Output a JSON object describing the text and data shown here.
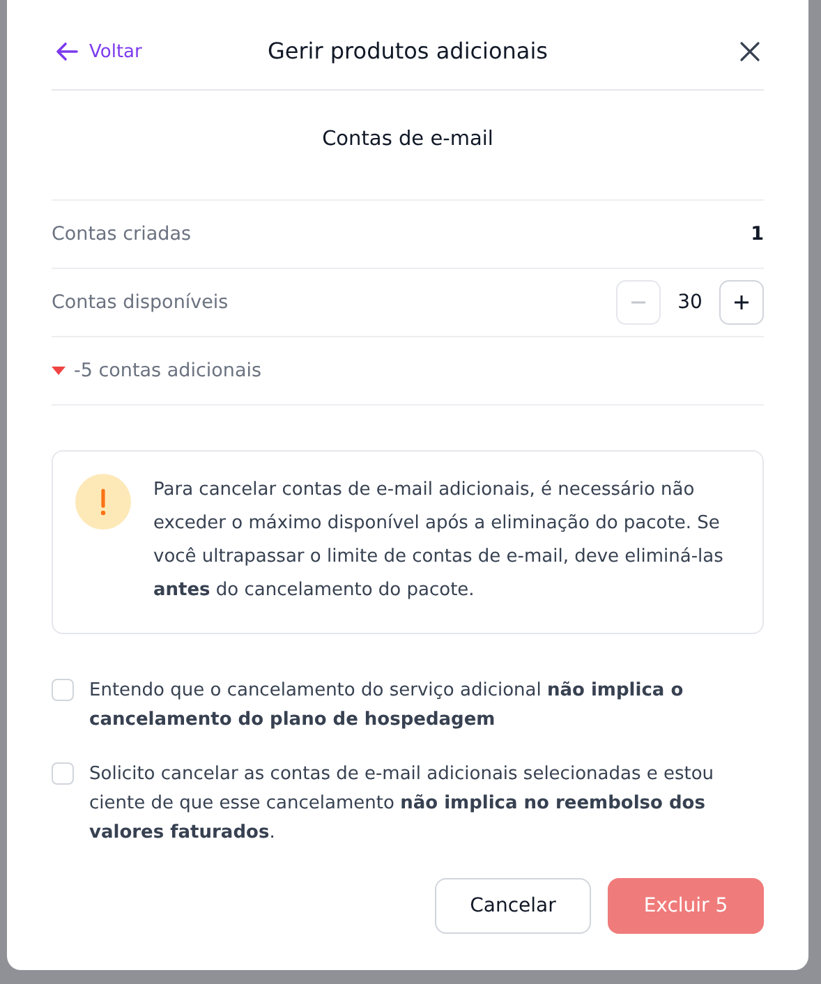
{
  "header": {
    "back": "Voltar",
    "title": "Gerir produtos adicionais"
  },
  "section_title": "Contas de e-mail",
  "rows": [
    {
      "kind": "value",
      "label": "Contas criadas",
      "value": "1"
    },
    {
      "kind": "stepper",
      "label": "Contas disponíveis",
      "value": "30",
      "minus_disabled": true,
      "plus_disabled": false
    },
    {
      "kind": "change",
      "label": "-5 contas adicionais",
      "decrease": true
    }
  ],
  "alert": {
    "text": "Para cancelar contas de e-mail adicionais, é necessário não exceder o máximo disponível após a eliminação do pacote. Se você ultrapassar o limite de contas de e-mail, deve eliminá-las **antes** do cancelamento do pacote."
  },
  "checkboxes": [
    {
      "label": "Entendo que o cancelamento do serviço adicional **não implica o cancelamento do plano de hospedagem**",
      "checked": false
    },
    {
      "label": "Solicito cancelar as contas de e-mail adicionais selecionadas e estou ciente de que esse cancelamento **não implica no reembolso dos valores faturados**.",
      "checked": false
    }
  ],
  "buttons": [
    {
      "kind": "secondary",
      "label": "Cancelar",
      "disabled": false
    },
    {
      "kind": "danger",
      "label": "Excluir 5",
      "disabled": true
    }
  ]
}
